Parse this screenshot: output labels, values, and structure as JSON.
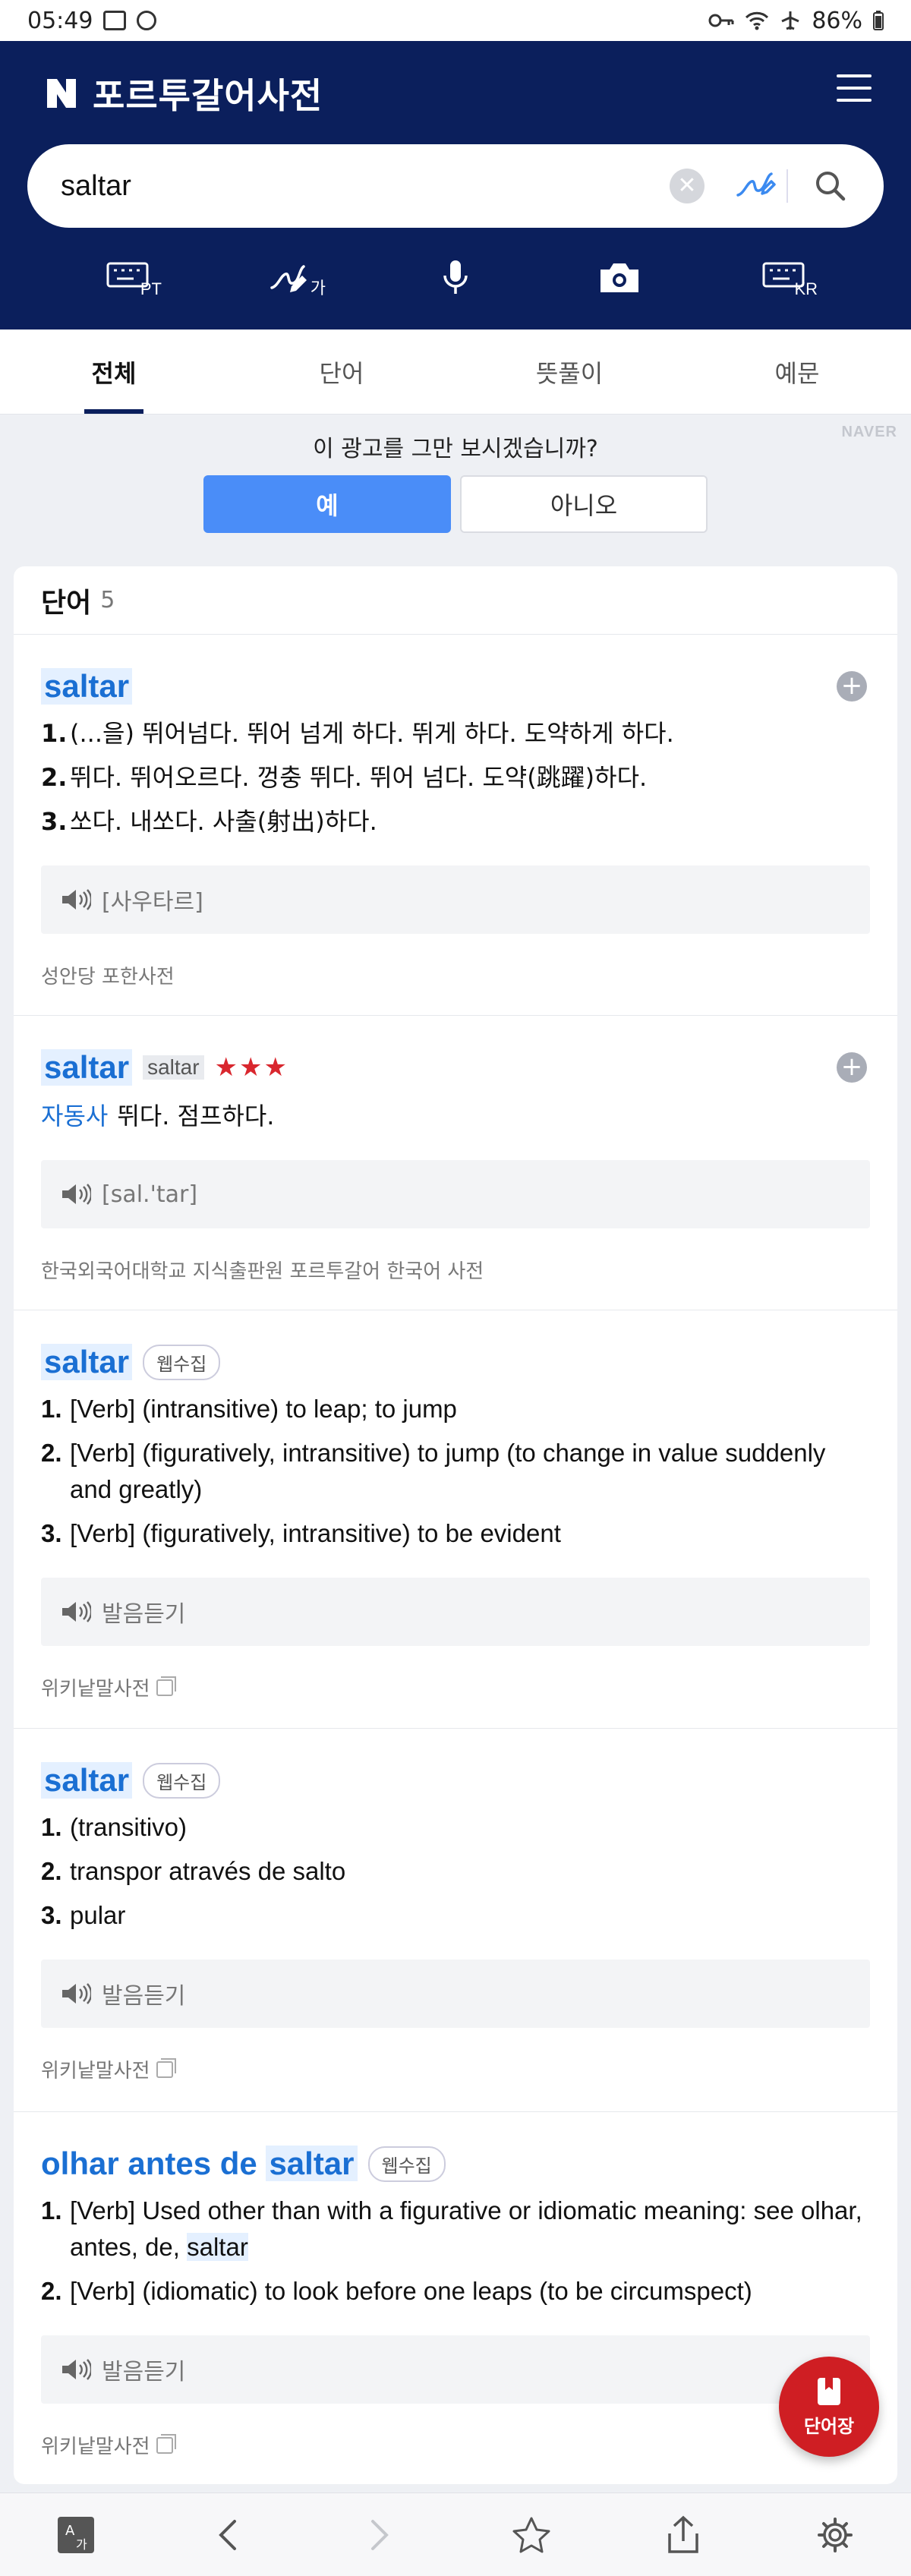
{
  "status": {
    "time": "05:49",
    "battery": "86%"
  },
  "app": {
    "title": "포르투갈어사전"
  },
  "search": {
    "value": "saltar"
  },
  "tools": [
    {
      "icon": "keyboard-pt-icon",
      "sub": "PT"
    },
    {
      "icon": "handwriting-ka-icon",
      "sub": "가"
    },
    {
      "icon": "microphone-icon",
      "sub": ""
    },
    {
      "icon": "camera-icon",
      "sub": ""
    },
    {
      "icon": "keyboard-kr-icon",
      "sub": "KR"
    }
  ],
  "tabs": [
    "전체",
    "단어",
    "뜻풀이",
    "예문"
  ],
  "ad": {
    "question": "이 광고를 그만 보시겠습니까?",
    "yes": "예",
    "no": "아니오",
    "brand": "NAVER"
  },
  "words": {
    "heading": "단어",
    "count": "5",
    "entries": [
      {
        "headword": "saltar",
        "defs": [
          {
            "num": "1.",
            "text": "(...을) 뛰어넘다. 뛰어 넘게 하다. 뛰게 하다. 도약하게 하다."
          },
          {
            "num": "2.",
            "text": "뛰다. 뛰어오르다. 껑충 뛰다. 뛰어 넘다. 도약(跳躍)하다."
          },
          {
            "num": "3.",
            "text": "쏘다. 내쏘다. 사출(射出)하다."
          }
        ],
        "pron": "[사우타르]",
        "source": "성안당 포한사전"
      },
      {
        "headword": "saltar",
        "sub": "saltar",
        "stars": "★★★",
        "pos": "자동사",
        "meaning": "뛰다. 점프하다.",
        "pron": "[sal.'tar]",
        "source": "한국외국어대학교 지식출판원 포르투갈어 한국어 사전"
      },
      {
        "headword": "saltar",
        "badge": "웹수집",
        "defs": [
          {
            "num": "1.",
            "text": "[Verb] (intransitive) to leap; to jump"
          },
          {
            "num": "2.",
            "text": "[Verb] (figuratively, intransitive) to jump (to change in value suddenly and greatly)"
          },
          {
            "num": "3.",
            "text": "[Verb] (figuratively, intransitive) to be evident"
          }
        ],
        "pron": "발음듣기",
        "source": "위키낱말사전"
      },
      {
        "headword": "saltar",
        "badge": "웹수집",
        "defs": [
          {
            "num": "1.",
            "text": "(transitivo)"
          },
          {
            "num": "2.",
            "text": "transpor através de salto"
          },
          {
            "num": "3.",
            "text": "pular"
          }
        ],
        "pron": "발음듣기",
        "source": "위키낱말사전"
      },
      {
        "headword_prefix": "olhar antes de",
        "headword_mark": "saltar",
        "badge": "웹수집",
        "def1_text": "[Verb] Used other than with a figurative or idiomatic meaning: see olhar, antes, de,",
        "def1_mark": "saltar",
        "def2_text": "[Verb] (idiomatic) to look before one leaps (to be circumspect)",
        "pron": "발음듣기",
        "source": "위키낱말사전"
      }
    ]
  },
  "fab": {
    "label": "단어장"
  },
  "colors": {
    "header": "#0b1f5c",
    "accent": "#1a6fd3",
    "fab": "#cf1e23",
    "yes_button": "#4a8df8"
  }
}
